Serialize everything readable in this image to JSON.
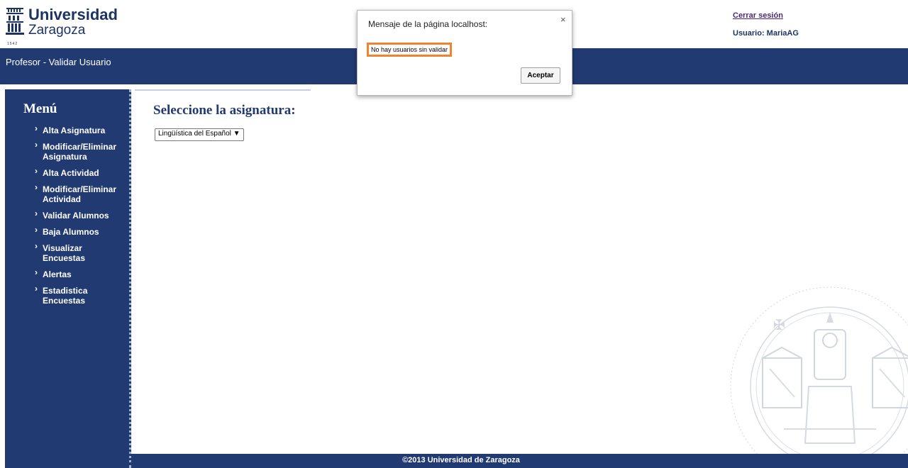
{
  "header": {
    "logo_name": "Universidad",
    "logo_city": "Zaragoza",
    "logo_year": "1542",
    "logout_label": "Cerrar sesión",
    "user_label": "Usuario: MariaAG"
  },
  "titlebar": {
    "text": "Profesor - Validar Usuario"
  },
  "sidebar": {
    "title": "Menú",
    "items": [
      {
        "label": "Alta Asignatura"
      },
      {
        "label": "Modificar/Eliminar Asignatura"
      },
      {
        "label": "Alta Actividad"
      },
      {
        "label": "Modificar/Eliminar Actividad"
      },
      {
        "label": "Validar Alumnos"
      },
      {
        "label": "Baja Alumnos"
      },
      {
        "label": "Visualizar Encuestas"
      },
      {
        "label": "Alertas"
      },
      {
        "label": "Estadistica Encuestas"
      }
    ]
  },
  "main": {
    "title": "Seleccione la asignatura:",
    "subject_select": {
      "selected": "Lingüística del Español ▼"
    }
  },
  "footer": {
    "text": "©2013 Universidad de Zaragoza"
  },
  "dialog": {
    "title": "Mensaje de la página localhost:",
    "close": "×",
    "message": "No hay usuarios sin validar",
    "ok_label": "Aceptar"
  },
  "colors": {
    "brand_navy": "#223a72",
    "dialog_highlight": "#f2832e",
    "link_purple": "#4b2a7e"
  }
}
